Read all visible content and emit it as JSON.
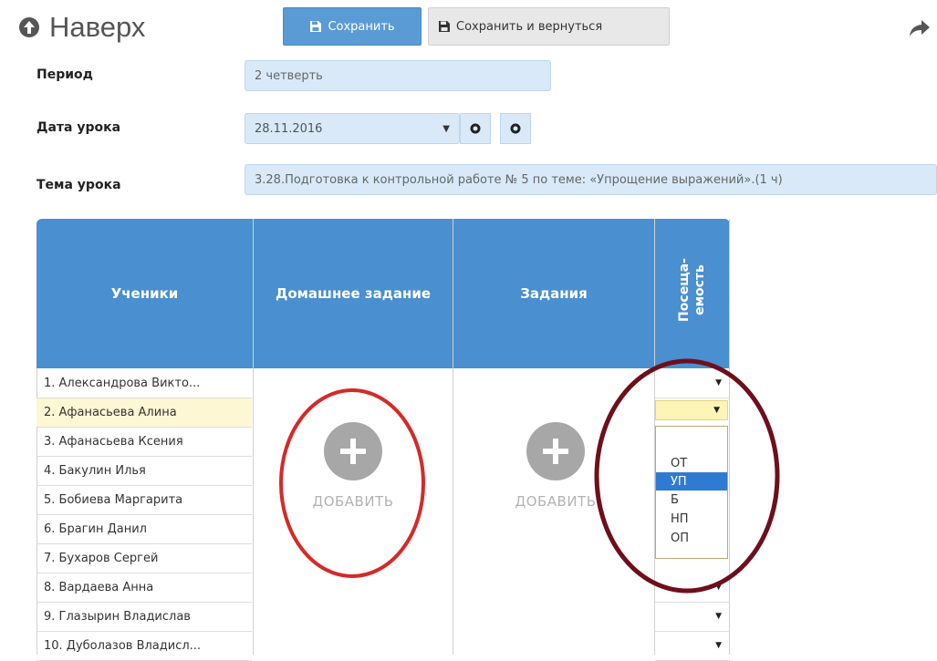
{
  "toolbar": {
    "back_label": "Наверх",
    "save_label": "Сохранить",
    "save_return_label": "Сохранить и вернуться"
  },
  "form": {
    "period_label": "Период",
    "period_value": "2 четверть",
    "date_label": "Дата урока",
    "date_value": "28.11.2016",
    "topic_label": "Тема урока",
    "topic_value": "3.28.Подготовка к контрольной работе № 5 по теме: «Упрощение выражений».(1 ч)"
  },
  "table": {
    "headers": {
      "students": "Ученики",
      "homework": "Домашнее задание",
      "tasks": "Задания",
      "attendance": "Посеща-\nемость"
    },
    "students": [
      "1. Александрова Викто...",
      "2. Афанасьева Алина",
      "3. Афанасьева Ксения",
      "4. Бакулин Илья",
      "5. Бобиева Маргарита",
      "6. Брагин Данил",
      "7. Бухаров Сергей",
      "8. Вардаева Анна",
      "9. Глазырин Владислав",
      "10. Дуболазов Владисл..."
    ],
    "add_label": "ДОБАВИТЬ",
    "add_label_tasks": "ДОБАВИТЬ",
    "attendance_options": [
      "ОТ",
      "УП",
      "Б",
      "НП",
      "ОП"
    ],
    "attendance_selected": "УП"
  },
  "colors": {
    "header_bg": "#4a8fcf",
    "field_bg": "#d9e9f8",
    "highlight_row": "#fdf7d4",
    "red_annotation": "#d42a2a",
    "maroon_annotation": "#6e0f1b"
  }
}
